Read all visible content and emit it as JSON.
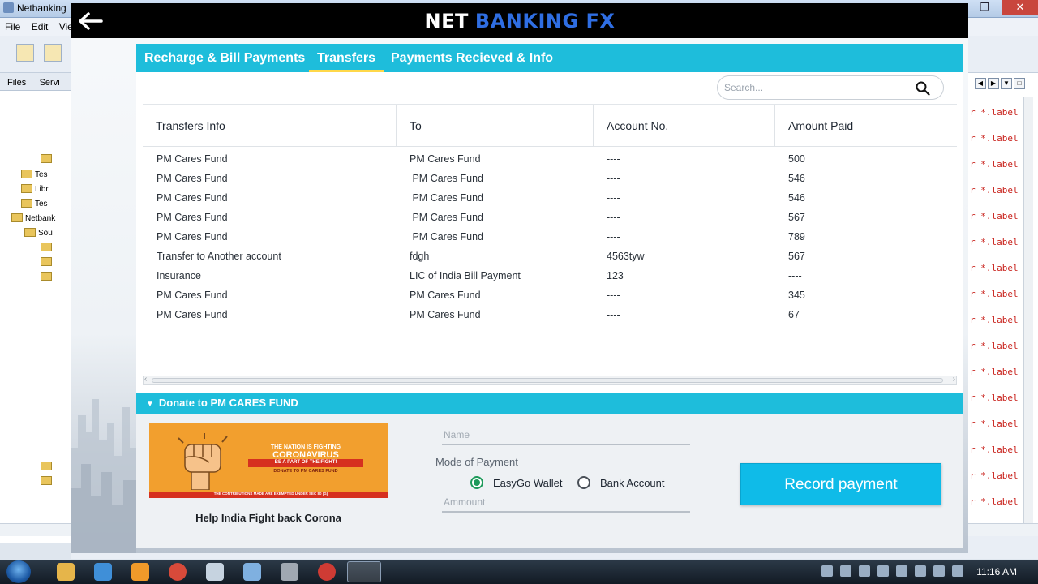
{
  "ide": {
    "title": "Netbanking",
    "menu": [
      "File",
      "Edit",
      "View"
    ],
    "left_tabs": [
      "Files",
      "Servi"
    ],
    "tree_items": [
      "Tes",
      "Libr",
      "Tes",
      "Netbank",
      "Sou"
    ],
    "code_line": "r *.label"
  },
  "app": {
    "title_part1": "NET",
    "title_part2": "BANKING  FX",
    "title_colors": {
      "part1": "#ffffff",
      "part2": "#2f6ee3"
    },
    "accent_color": "#1ebddb",
    "tabs": [
      {
        "label": "Recharge & Bill Payments",
        "active": false
      },
      {
        "label": "Transfers",
        "active": true
      },
      {
        "label": "Payments Recieved & Info",
        "active": false
      }
    ],
    "search": {
      "placeholder": "Search...",
      "icon": "search-icon"
    },
    "table": {
      "headers": [
        "Transfers Info",
        "To",
        "Account No.",
        "Amount Paid"
      ],
      "rows": [
        [
          "PM Cares Fund",
          "PM Cares Fund",
          "----",
          "500"
        ],
        [
          "PM Cares Fund",
          " PM Cares Fund",
          "----",
          "546"
        ],
        [
          "PM Cares Fund",
          " PM Cares Fund",
          "----",
          "546"
        ],
        [
          "PM Cares Fund",
          " PM Cares Fund",
          "----",
          "567"
        ],
        [
          "PM Cares Fund",
          " PM Cares Fund",
          "----",
          "789"
        ],
        [
          "Transfer to Another account",
          "fdgh",
          "4563tyw",
          "567"
        ],
        [
          "Insurance",
          "LIC of India Bill Payment",
          "123",
          "----"
        ],
        [
          "PM Cares Fund",
          "PM Cares Fund",
          "----",
          "345"
        ],
        [
          "PM Cares Fund",
          "PM Cares Fund",
          "----",
          "67"
        ]
      ]
    },
    "donate": {
      "header": "Donate to PM CARES FUND",
      "banner_caption": "Help India Fight back Corona",
      "banner_text": {
        "line1": "THE NATION IS FIGHTING",
        "line2": "CORONAVIRUS",
        "line3": "BE A PART OF THE FIGHT!",
        "line4": "DONATE TO PM CARES FUND",
        "line5": "THE CONTRIBUTIONS MADE ARE EXEMPTED UNDER SEC 80 (G)"
      },
      "name_placeholder": "Name",
      "mode_label": "Mode of Payment",
      "modes": [
        {
          "label": "EasyGo Wallet",
          "selected": true
        },
        {
          "label": "Bank Account",
          "selected": false
        }
      ],
      "amount_placeholder": "Ammount",
      "record_button": "Record payment"
    }
  },
  "taskbar": {
    "clock": "11:16 AM"
  }
}
